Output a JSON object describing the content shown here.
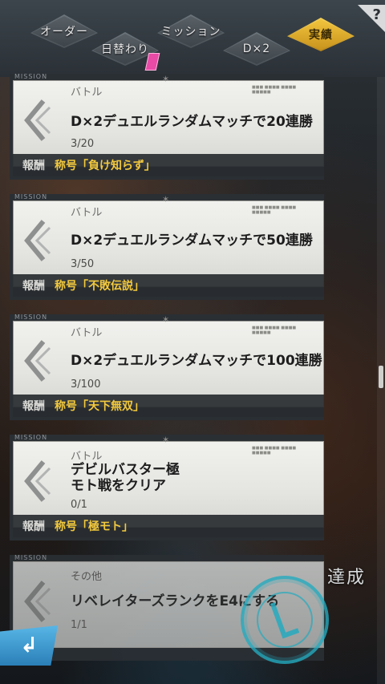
{
  "tabs": [
    {
      "label": "オーダー"
    },
    {
      "label": "日替わり"
    },
    {
      "label": "ミッション"
    },
    {
      "label": "D×2"
    },
    {
      "label": "実績"
    }
  ],
  "help_label": "?",
  "missions": [
    {
      "tag": "MISSION",
      "category": "バトル",
      "title": "D×2デュエルランダムマッチで20連勝",
      "progress": "3/20",
      "reward_label": "報酬",
      "reward": "称号「負け知らず」"
    },
    {
      "tag": "MISSION",
      "category": "バトル",
      "title": "D×2デュエルランダムマッチで50連勝",
      "progress": "3/50",
      "reward_label": "報酬",
      "reward": "称号「不敗伝説」"
    },
    {
      "tag": "MISSION",
      "category": "バトル",
      "title": "D×2デュエルランダムマッチで100連勝",
      "progress": "3/100",
      "reward_label": "報酬",
      "reward": "称号「天下無双」"
    },
    {
      "tag": "MISSION",
      "category": "バトル",
      "title": "デビルバスター極\nモト戦をクリア",
      "progress": "0/1",
      "reward_label": "報酬",
      "reward": "称号「極モト」"
    },
    {
      "tag": "MISSION",
      "category": "その他",
      "title": "リベレイターズランクをE4にする",
      "progress": "1/1"
    }
  ],
  "achieved_label": "達成",
  "back_icon": "return-arrow-icon"
}
